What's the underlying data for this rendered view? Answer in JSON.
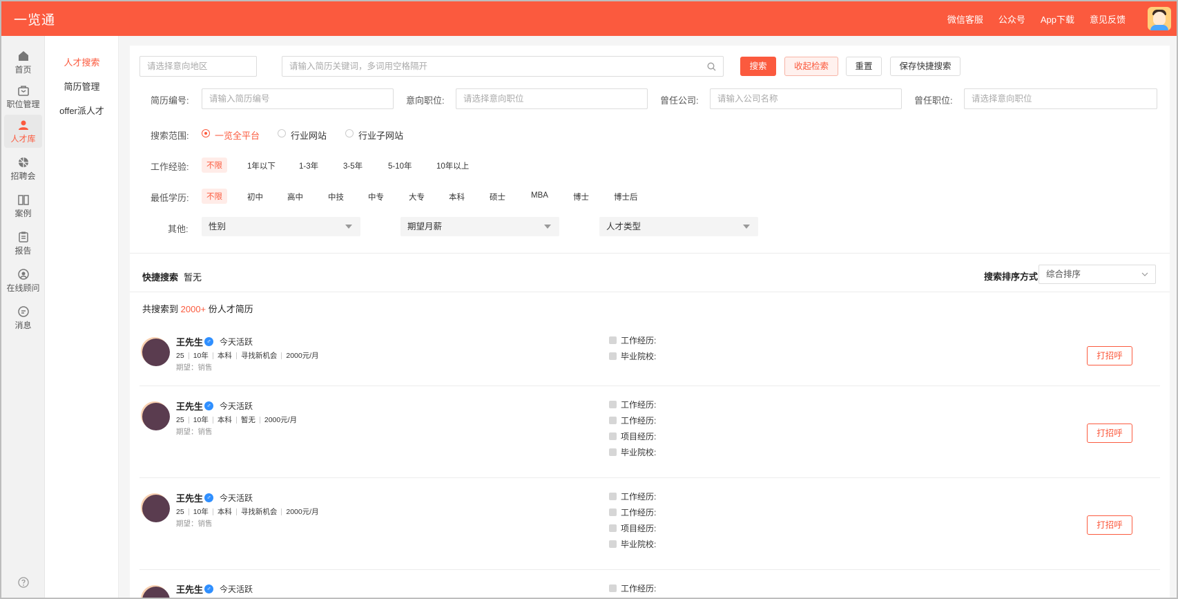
{
  "header": {
    "logo": "一览通",
    "links": [
      "微信客服",
      "公众号",
      "App下载",
      "意见反馈"
    ]
  },
  "sidebar": {
    "items": [
      {
        "label": "首页",
        "icon": "home-icon"
      },
      {
        "label": "职位管理",
        "icon": "briefcase-icon"
      },
      {
        "label": "人才库",
        "icon": "person-icon"
      },
      {
        "label": "招聘会",
        "icon": "aperture-icon"
      },
      {
        "label": "案例",
        "icon": "book-icon"
      },
      {
        "label": "报告",
        "icon": "clipboard-icon"
      },
      {
        "label": "在线顾问",
        "icon": "consultant-icon"
      },
      {
        "label": "消息",
        "icon": "message-icon"
      }
    ]
  },
  "subnav": [
    "人才搜索",
    "简历管理",
    "offer派人才"
  ],
  "search": {
    "region_placeholder": "请选择意向地区",
    "keyword_placeholder": "请输入简历关键词，多词用空格隔开",
    "search_btn": "搜索",
    "collapse_btn": "收起检索",
    "reset_btn": "重置",
    "save_btn": "保存快捷搜索"
  },
  "filters": {
    "resume_no_label": "简历编号:",
    "resume_no_placeholder": "请输入简历编号",
    "position_label": "意向职位:",
    "position_placeholder": "请选择意向职位",
    "company_label": "曾任公司:",
    "company_placeholder": "请输入公司名称",
    "prev_position_label": "曾任职位:",
    "prev_position_placeholder": "请选择意向职位",
    "scope_label": "搜索范围:",
    "scope_options": [
      "一览全平台",
      "行业网站",
      "行业子网站"
    ],
    "experience_label": "工作经验:",
    "experience_options": [
      "不限",
      "1年以下",
      "1-3年",
      "3-5年",
      "5-10年",
      "10年以上"
    ],
    "education_label": "最低学历:",
    "education_options": [
      "不限",
      "初中",
      "高中",
      "中技",
      "中专",
      "大专",
      "本科",
      "硕士",
      "MBA",
      "博士",
      "博士后"
    ],
    "other_label": "其他:",
    "other_selects": [
      "性别",
      "期望月薪",
      "人才类型"
    ]
  },
  "quick": {
    "label": "快捷搜索",
    "value": "暂无",
    "sort_label": "搜索排序方式",
    "sort_value": "综合排序"
  },
  "results": {
    "prefix": "共搜索到",
    "count": "2000+",
    "suffix": "份人才简历"
  },
  "candidates": [
    {
      "name": "王先生",
      "active": "今天活跃",
      "age": "25",
      "years": "10年",
      "edu": "本科",
      "status": "寻找新机会",
      "salary": "2000元/月",
      "expect": "期望：销售",
      "rows": [
        "工作经历:",
        "毕业院校:"
      ],
      "action": "打招呼"
    },
    {
      "name": "王先生",
      "active": "今天活跃",
      "age": "25",
      "years": "10年",
      "edu": "本科",
      "status": "暂无",
      "salary": "2000元/月",
      "expect": "期望：销售",
      "rows": [
        "工作经历:",
        "工作经历:",
        "项目经历:",
        "毕业院校:"
      ],
      "action": "打招呼"
    },
    {
      "name": "王先生",
      "active": "今天活跃",
      "age": "25",
      "years": "10年",
      "edu": "本科",
      "status": "寻找新机会",
      "salary": "2000元/月",
      "expect": "期望：销售",
      "rows": [
        "工作经历:",
        "工作经历:",
        "项目经历:",
        "毕业院校:"
      ],
      "action": "打招呼"
    },
    {
      "name": "王先生",
      "active": "今天活跃",
      "rows": [
        "工作经历:"
      ]
    }
  ],
  "colors": {
    "accent": "#fb5a3e"
  }
}
